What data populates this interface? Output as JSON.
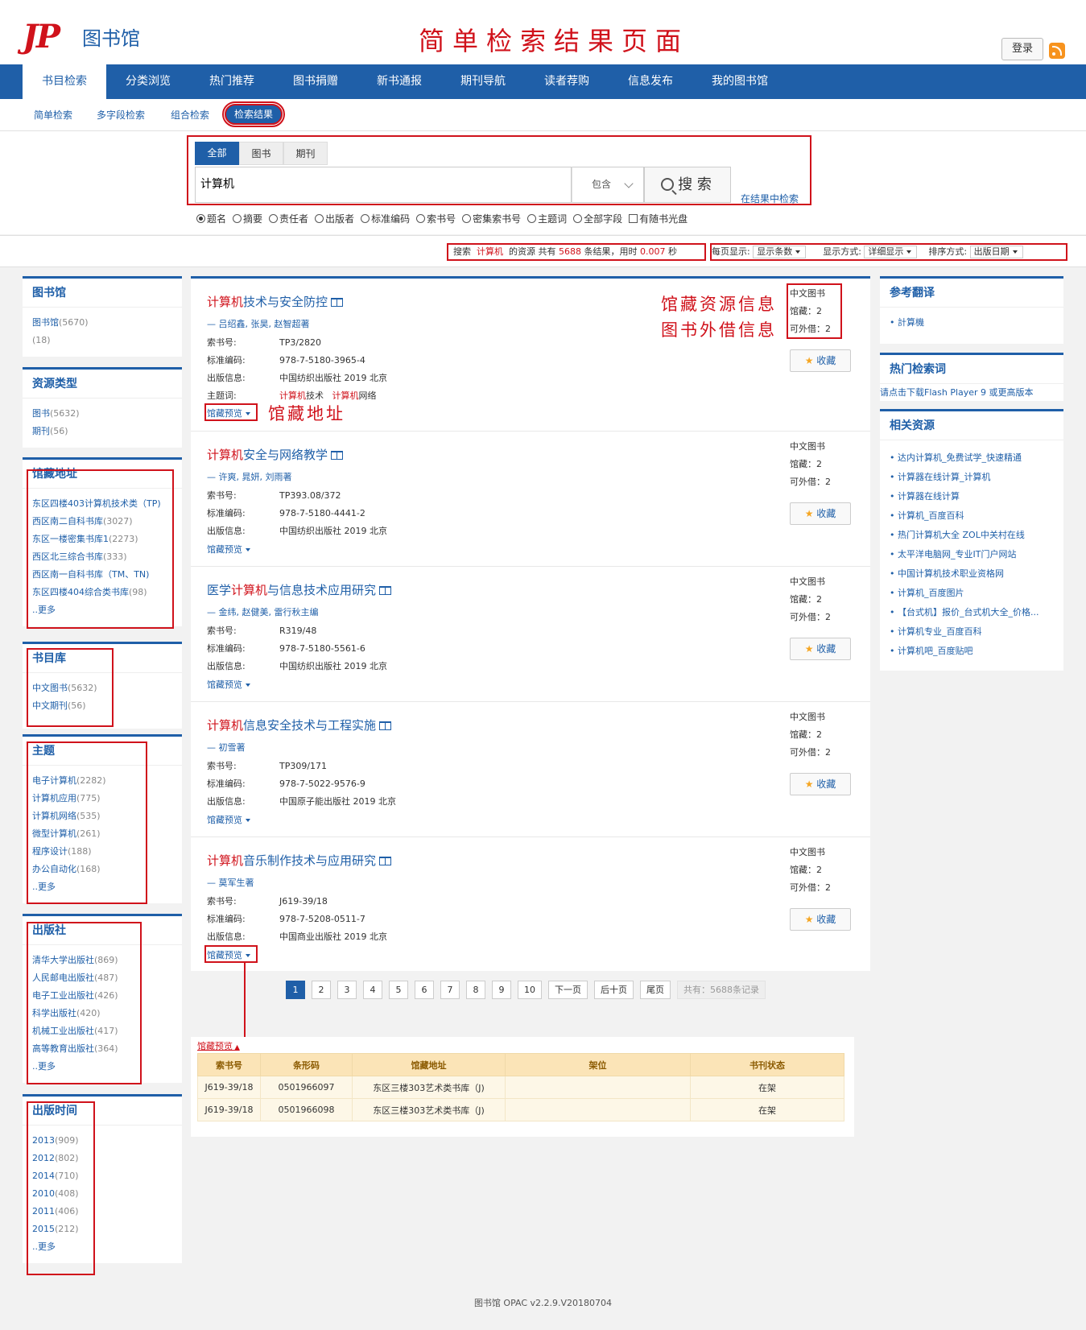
{
  "header": {
    "logo_mark": "JP",
    "logo_text": "图书馆",
    "page_heading": "简单检索结果页面",
    "login_label": "登录"
  },
  "main_nav": [
    "书目检索",
    "分类浏览",
    "热门推荐",
    "图书捐赠",
    "新书通报",
    "期刊导航",
    "读者荐购",
    "信息发布",
    "我的图书馆"
  ],
  "sub_nav": [
    "简单检索",
    "多字段检索",
    "组合检索",
    "检索结果"
  ],
  "search": {
    "tabs": [
      "全部",
      "图书",
      "期刊"
    ],
    "query": "计算机",
    "match_mode": "包含",
    "button_label": "搜 索",
    "within_results": "在结果中检索",
    "fields": [
      "题名",
      "摘要",
      "责任者",
      "出版者",
      "标准编码",
      "索书号",
      "密集索书号",
      "主题词",
      "全部字段"
    ],
    "checkbox_label": "有随书光盘"
  },
  "stats": {
    "prefix": "搜索",
    "keyword": "计算机",
    "middle": "的资源 共有",
    "count": "5688",
    "suffix": "条结果，用时",
    "time": "0.007",
    "unit": "秒"
  },
  "display_controls": {
    "per_page_label": "每页显示:",
    "per_page_value": "显示条数",
    "display_label": "显示方式:",
    "display_value": "详细显示",
    "sort_label": "排序方式:",
    "sort_value": "出版日期"
  },
  "left_panels": {
    "library": {
      "title": "图书馆",
      "items": [
        {
          "name": "图书馆",
          "count": "(5670)"
        },
        {
          "name": "",
          "count": "(18)"
        }
      ]
    },
    "resource_type": {
      "title": "资源类型",
      "items": [
        {
          "name": "图书",
          "count": "(5632)"
        },
        {
          "name": "期刊",
          "count": "(56)"
        }
      ]
    },
    "location": {
      "title": "馆藏地址",
      "items": [
        {
          "name": "东区四楼403计算机技术类（TP)",
          "count": ""
        },
        {
          "name": "西区南二自科书库",
          "count": "(3027)"
        },
        {
          "name": "东区一楼密集书库1",
          "count": "(2273)"
        },
        {
          "name": "西区北三综合书库",
          "count": "(333)"
        },
        {
          "name": "西区南一自科书库（TM、TN)",
          "count": ""
        },
        {
          "name": "东区四楼404综合类书库",
          "count": "(98)"
        }
      ],
      "more": "..更多"
    },
    "catalog": {
      "title": "书目库",
      "items": [
        {
          "name": "中文图书",
          "count": "(5632)"
        },
        {
          "name": "中文期刊",
          "count": "(56)"
        }
      ]
    },
    "subject": {
      "title": "主题",
      "items": [
        {
          "name": "电子计算机",
          "count": "(2282)"
        },
        {
          "name": "计算机应用",
          "count": "(775)"
        },
        {
          "name": "计算机网络",
          "count": "(535)"
        },
        {
          "name": "微型计算机",
          "count": "(261)"
        },
        {
          "name": "程序设计",
          "count": "(188)"
        },
        {
          "name": "办公自动化",
          "count": "(168)"
        }
      ],
      "more": "..更多"
    },
    "publisher": {
      "title": "出版社",
      "items": [
        {
          "name": "清华大学出版社",
          "count": "(869)"
        },
        {
          "name": "人民邮电出版社",
          "count": "(487)"
        },
        {
          "name": "电子工业出版社",
          "count": "(426)"
        },
        {
          "name": "科学出版社",
          "count": "(420)"
        },
        {
          "name": "机械工业出版社",
          "count": "(417)"
        },
        {
          "name": "高等教育出版社",
          "count": "(364)"
        }
      ],
      "more": "..更多"
    },
    "year": {
      "title": "出版时间",
      "items": [
        {
          "name": "2013",
          "count": "(909)"
        },
        {
          "name": "2012",
          "count": "(802)"
        },
        {
          "name": "2014",
          "count": "(710)"
        },
        {
          "name": "2010",
          "count": "(408)"
        },
        {
          "name": "2011",
          "count": "(406)"
        },
        {
          "name": "2015",
          "count": "(212)"
        }
      ],
      "more": "..更多"
    }
  },
  "labels": {
    "call_no": "索书号:",
    "isbn": "标准编码:",
    "pub": "出版信息:",
    "subject": "主题词:",
    "preview": "馆藏预览",
    "holdings_prefix": "馆藏：",
    "lendable_prefix": "可外借：",
    "fav": "收藏"
  },
  "results": [
    {
      "title_hl": "计算机",
      "title_rest": "技术与安全防控",
      "authors": "— 吕绍鑫, 张昊, 赵智超著",
      "call_no": "TP3/2820",
      "isbn": "978-7-5180-3965-4",
      "pub": "中国纺织出版社  2019  北京",
      "subjects": [
        {
          "hl": "计算机",
          "rest": "技术"
        },
        {
          "hl": "计算机",
          "rest": "网络"
        }
      ],
      "catalog": "中文图书",
      "holdings": "2",
      "lendable": "2"
    },
    {
      "title_hl": "计算机",
      "title_rest": "安全与网络教学",
      "authors": "— 许爽, 晁妍, 刘雨著",
      "call_no": "TP393.08/372",
      "isbn": "978-7-5180-4441-2",
      "pub": "中国纺织出版社  2019  北京",
      "catalog": "中文图书",
      "holdings": "2",
      "lendable": "2"
    },
    {
      "title_pre": "医学",
      "title_hl": "计算机",
      "title_rest": "与信息技术应用研究",
      "authors": "— 金纬, 赵健美, 雷行秋主编",
      "call_no": "R319/48",
      "isbn": "978-7-5180-5561-6",
      "pub": "中国纺织出版社  2019  北京",
      "catalog": "中文图书",
      "holdings": "2",
      "lendable": "2"
    },
    {
      "title_hl": "计算机",
      "title_rest": "信息安全技术与工程实施",
      "authors": "— 初雪著",
      "call_no": "TP309/171",
      "isbn": "978-7-5022-9576-9",
      "pub": "中国原子能出版社  2019  北京",
      "catalog": "中文图书",
      "holdings": "2",
      "lendable": "2"
    },
    {
      "title_hl": "计算机",
      "title_rest": "音乐制作技术与应用研究",
      "authors": "— 莫军生著",
      "call_no": "J619-39/18",
      "isbn": "978-7-5208-0511-7",
      "pub": "中国商业出版社  2019  北京",
      "catalog": "中文图书",
      "holdings": "2",
      "lendable": "2"
    }
  ],
  "annotations": {
    "res_info": "馆藏资源信息",
    "lend_info": "图书外借信息",
    "location": "馆藏地址"
  },
  "pagination": {
    "pages": [
      "1",
      "2",
      "3",
      "4",
      "5",
      "6",
      "7",
      "8",
      "9",
      "10"
    ],
    "next": "下一页",
    "next10": "后十页",
    "last": "尾页",
    "total": "共有：5688条记录"
  },
  "holdings_detail": {
    "toggle": "馆藏预览",
    "headers": [
      "索书号",
      "条形码",
      "馆藏地址",
      "架位",
      "书刊状态"
    ],
    "rows": [
      [
        "J619-39/18",
        "0501966097",
        "东区三楼303艺术类书库（J)",
        "",
        "在架"
      ],
      [
        "J619-39/18",
        "0501966098",
        "东区三楼303艺术类书库（J)",
        "",
        "在架"
      ]
    ]
  },
  "right_panels": {
    "translate": {
      "title": "参考翻译",
      "items": [
        "計算機"
      ]
    },
    "hot": {
      "title": "热门检索词",
      "text": "请点击下载Flash Player 9 或更高版本"
    },
    "related": {
      "title": "相关资源",
      "items": [
        "达内计算机_免费试学_快速精通",
        "计算器在线计算_计算机",
        "计算器在线计算",
        "计算机_百度百科",
        "热门计算机大全 ZOL中关村在线",
        "太平洋电脑网_专业IT门户网站",
        "中国计算机技术职业资格网",
        "计算机_百度图片",
        "【台式机】报价_台式机大全_价格...",
        "计算机专业_百度百科",
        "计算机吧_百度贴吧"
      ]
    }
  },
  "footer": "图书馆  OPAC v2.2.9.V20180704"
}
